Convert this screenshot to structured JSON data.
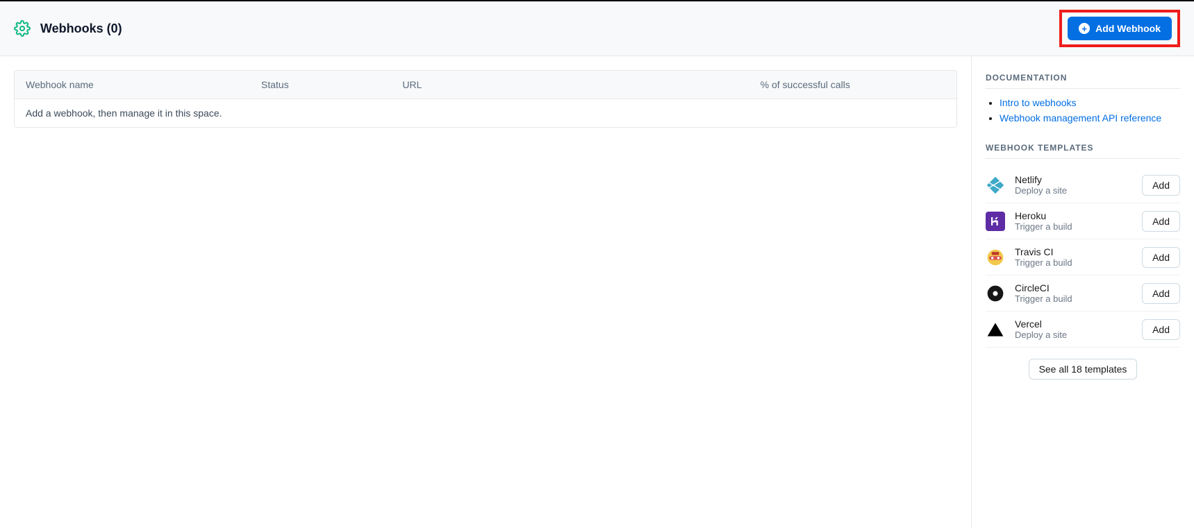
{
  "header": {
    "title": "Webhooks (0)",
    "add_button_label": "Add Webhook"
  },
  "table": {
    "columns": {
      "name": "Webhook name",
      "status": "Status",
      "url": "URL",
      "pct": "% of successful calls"
    },
    "empty_message": "Add a webhook, then manage it in this space."
  },
  "sidebar": {
    "docs": {
      "title": "DOCUMENTATION",
      "links": [
        {
          "label": "Intro to webhooks"
        },
        {
          "label": "Webhook management API reference"
        }
      ]
    },
    "templates": {
      "title": "WEBHOOK TEMPLATES",
      "items": [
        {
          "name": "Netlify",
          "desc": "Deploy a site",
          "button": "Add"
        },
        {
          "name": "Heroku",
          "desc": "Trigger a build",
          "button": "Add"
        },
        {
          "name": "Travis CI",
          "desc": "Trigger a build",
          "button": "Add"
        },
        {
          "name": "CircleCI",
          "desc": "Trigger a build",
          "button": "Add"
        },
        {
          "name": "Vercel",
          "desc": "Deploy a site",
          "button": "Add"
        }
      ],
      "see_all_label": "See all 18 templates"
    }
  }
}
